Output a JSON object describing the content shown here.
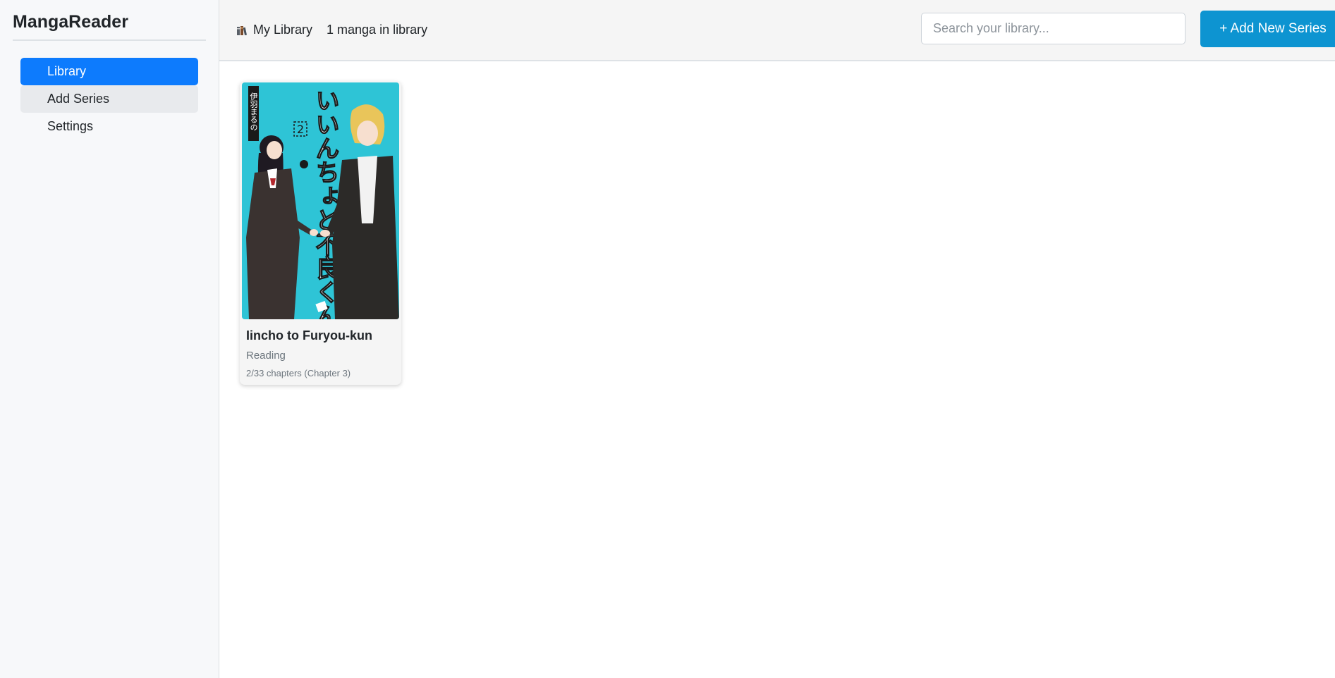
{
  "app": {
    "brand": "MangaReader"
  },
  "sidebar": {
    "items": [
      {
        "label": "Library",
        "state": "active"
      },
      {
        "label": "Add Series",
        "state": "hover"
      },
      {
        "label": "Settings",
        "state": "default"
      }
    ]
  },
  "header": {
    "icon": "books-icon",
    "title": "My Library",
    "count_text": "1 manga in library",
    "search_placeholder": "Search your library...",
    "add_button_label": "+ Add New Series"
  },
  "library": {
    "items": [
      {
        "title": "Iincho to Furyou-kun",
        "status": "Reading",
        "progress_text": "2/33 chapters (Chapter 3)",
        "cover_text": "いいんちょと不良くん",
        "cover_volume": "2",
        "cover_author": "伊羽まるの"
      }
    ]
  },
  "colors": {
    "accent": "#0d7bfd",
    "add_button": "#0d94d1",
    "cover_bg": "#2ec4d6"
  }
}
